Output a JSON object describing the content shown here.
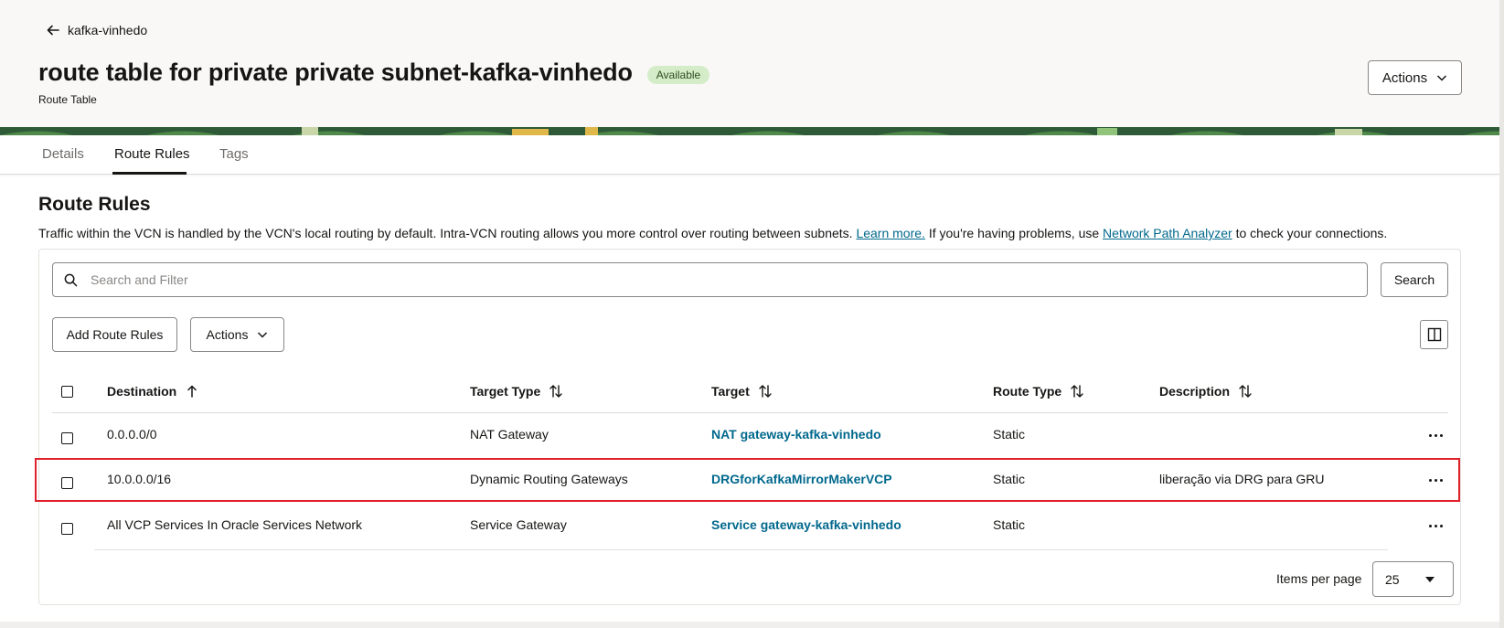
{
  "header": {
    "back_label": "kafka-vinhedo",
    "title": "route table for private private subnet-kafka-vinhedo",
    "status": "Available",
    "subtitle": "Route Table",
    "actions_label": "Actions"
  },
  "tabs": [
    {
      "label": "Details",
      "active": false
    },
    {
      "label": "Route Rules",
      "active": true
    },
    {
      "label": "Tags",
      "active": false
    }
  ],
  "section": {
    "title": "Route Rules",
    "desc_part1": "Traffic within the VCN is handled by the VCN's local routing by default. Intra-VCN routing allows you more control over routing between subnets.",
    "learn_more": "Learn more.",
    "desc_part2": "If you're having problems, use",
    "analyzer_link": "Network Path Analyzer",
    "desc_part3": "to check your connections."
  },
  "search": {
    "placeholder": "Search and Filter",
    "button_label": "Search"
  },
  "toolbar": {
    "add_label": "Add Route Rules",
    "actions_label": "Actions"
  },
  "table": {
    "columns": [
      "Destination",
      "Target Type",
      "Target",
      "Route Type",
      "Description"
    ],
    "rows": [
      {
        "destination": "0.0.0.0/0",
        "target_type": "NAT Gateway",
        "target": "NAT gateway-kafka-vinhedo",
        "route_type": "Static",
        "description": ""
      },
      {
        "destination": "10.0.0.0/16",
        "target_type": "Dynamic Routing Gateways",
        "target": "DRGforKafkaMirrorMakerVCP",
        "route_type": "Static",
        "description": "liberação via DRG para GRU"
      },
      {
        "destination": "All VCP Services In Oracle Services Network",
        "target_type": "Service Gateway",
        "target": "Service gateway-kafka-vinhedo",
        "route_type": "Static",
        "description": ""
      }
    ]
  },
  "pagination": {
    "label": "Items per page",
    "value": "25"
  },
  "colors": {
    "link": "#00688c",
    "highlight": "#e0202a",
    "badge_bg": "#d4edc8"
  }
}
